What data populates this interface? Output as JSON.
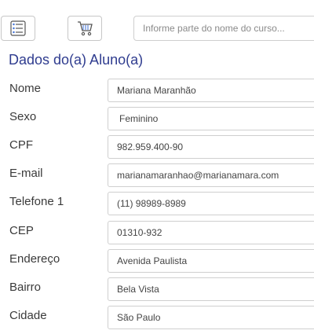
{
  "toolbar": {
    "menu_icon": "list-icon",
    "cart_icon": "shopping-cart-icon",
    "search_placeholder": "Informe parte do nome do curso..."
  },
  "section_title": "Dados do(a) Aluno(a)",
  "form": {
    "nome": {
      "label": "Nome",
      "value": "Mariana Maranhão"
    },
    "sexo": {
      "label": "Sexo",
      "value": "Feminino"
    },
    "cpf": {
      "label": "CPF",
      "value": "982.959.400-90"
    },
    "email": {
      "label": "E-mail",
      "value": "marianamaranhao@marianamara.com"
    },
    "telefone": {
      "label": "Telefone 1",
      "value": "(11) 98989-8989"
    },
    "cep": {
      "label": "CEP",
      "value": "01310-932"
    },
    "endereco": {
      "label": "Endereço",
      "value": "Avenida Paulista"
    },
    "bairro": {
      "label": "Bairro",
      "value": "Bela Vista"
    },
    "cidade": {
      "label": "Cidade",
      "value": "São Paulo"
    }
  },
  "colors": {
    "title": "#2f3c8f",
    "icon_accent": "#3d6fd6"
  }
}
